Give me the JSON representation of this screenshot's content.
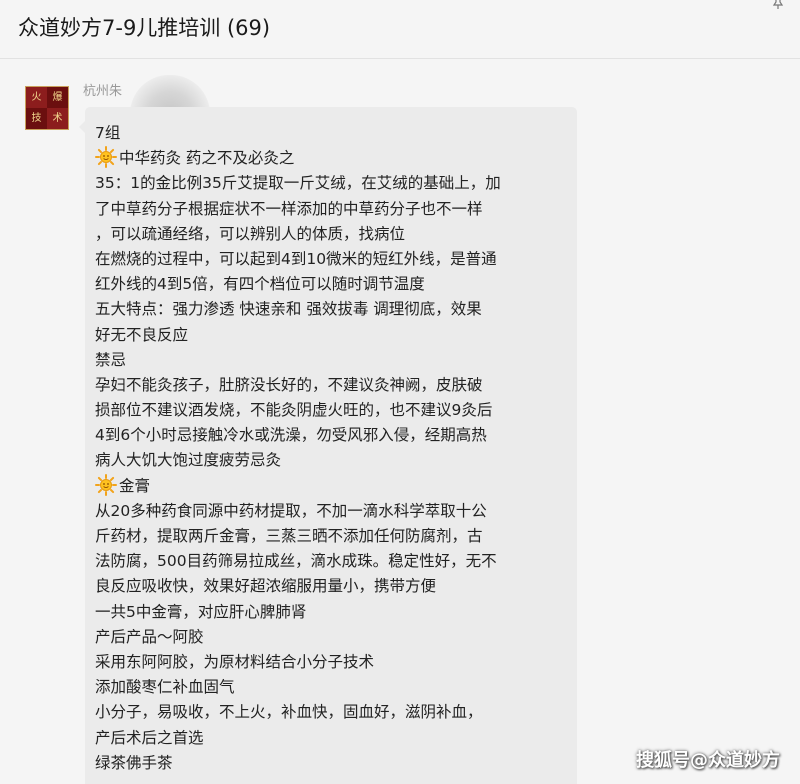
{
  "header": {
    "title": "众道妙方7-9儿推培训 (69)",
    "pin_icon": "pin-icon"
  },
  "message": {
    "sender": "杭州朱",
    "avatar_chars": [
      "火",
      "爆",
      "技",
      "术"
    ],
    "lines": [
      {
        "text": "7组",
        "icon": null
      },
      {
        "text": "中华药灸  药之不及必灸之",
        "icon": "sun-emoji-icon"
      },
      {
        "text": "35：1的金比例35斤艾提取一斤艾绒，在艾绒的基础上，加",
        "icon": null
      },
      {
        "text": "了中草药分子根据症状不一样添加的中草药分子也不一样",
        "icon": null
      },
      {
        "text": "，可以疏通经络，可以辨别人的体质，找病位",
        "icon": null
      },
      {
        "text": "在燃烧的过程中，可以起到4到10微米的短红外线，是普通",
        "icon": null
      },
      {
        "text": "红外线的4到5倍，有四个档位可以随时调节温度",
        "icon": null
      },
      {
        "text": "五大特点：强力渗透  快速亲和  强效拔毒  调理彻底，效果",
        "icon": null
      },
      {
        "text": "好无不良反应",
        "icon": null
      },
      {
        "text": "禁忌",
        "icon": null
      },
      {
        "text": "孕妇不能灸孩子，肚脐没长好的，不建议灸神阙，皮肤破",
        "icon": null
      },
      {
        "text": "损部位不建议酒发烧，不能灸阴虚火旺的，也不建议9灸后",
        "icon": null
      },
      {
        "text": "4到6个小时忌接触冷水或洗澡，勿受风邪入侵，经期高热",
        "icon": null
      },
      {
        "text": "病人大饥大饱过度疲劳忌灸",
        "icon": null
      },
      {
        "text": "金膏",
        "icon": "sun-emoji-icon"
      },
      {
        "text": "从20多种药食同源中药材提取，不加一滴水科学萃取十公",
        "icon": null
      },
      {
        "text": "斤药材，提取两斤金膏，三蒸三晒不添加任何防腐剂，古",
        "icon": null
      },
      {
        "text": "法防腐，500目药筛易拉成丝，滴水成珠。稳定性好，无不",
        "icon": null
      },
      {
        "text": "良反应吸收快，效果好超浓缩服用量小，携带方便",
        "icon": null
      },
      {
        "text": "一共5中金膏，对应肝心脾肺肾",
        "icon": null
      },
      {
        "text": "产后产品～阿胶",
        "icon": null
      },
      {
        "text": "采用东阿阿胶，为原材料结合小分子技术",
        "icon": null
      },
      {
        "text": "添加酸枣仁补血固气",
        "icon": null
      },
      {
        "text": "小分子，易吸收，不上火，补血快，固血好，滋阴补血，",
        "icon": null
      },
      {
        "text": "产后术后之首选",
        "icon": null
      },
      {
        "text": "绿茶佛手茶",
        "icon": null
      }
    ]
  },
  "watermark": "搜狐号@众道妙方",
  "colors": {
    "background": "#f5f5f5",
    "bubble": "#ebebeb",
    "text": "#222222",
    "sender": "#999999"
  }
}
